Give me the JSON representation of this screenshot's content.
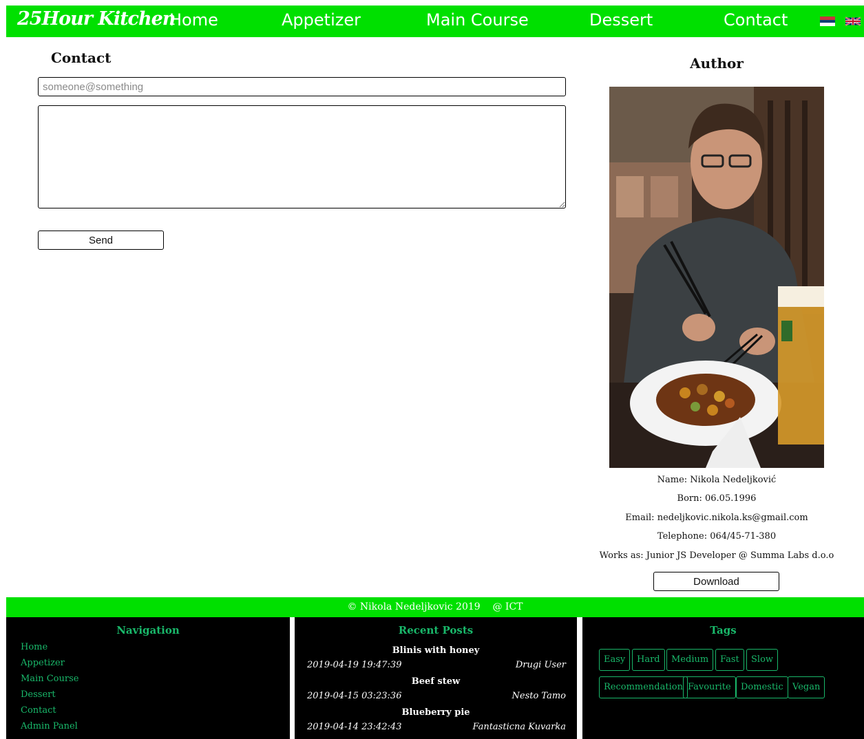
{
  "nav": {
    "brand": "25Hour Kitchen",
    "links": [
      "Home",
      "Appetizer",
      "Main Course",
      "Dessert",
      "Contact"
    ],
    "languages": [
      "serbian-flag",
      "uk-flag"
    ]
  },
  "contact": {
    "title": "Contact",
    "email_placeholder": "someone@something",
    "send_label": "Send"
  },
  "author": {
    "title": "Author",
    "name": "Name: Nikola Nedeljković",
    "born": "Born: 06.05.1996",
    "email": "Email: nedeljkovic.nikola.ks@gmail.com",
    "telephone": "Telephone: 064/45-71-380",
    "works_as": "Works as: Junior JS Developer @ Summa Labs d.o.o",
    "download_label": "Download"
  },
  "footer": {
    "copyright": "© Nikola Nedeljkovic 2019    @ ICT",
    "navigation": {
      "heading": "Navigation",
      "links": [
        "Home",
        "Appetizer",
        "Main Course",
        "Dessert",
        "Contact",
        "Admin Panel"
      ]
    },
    "recent_posts": {
      "heading": "Recent Posts",
      "posts": [
        {
          "title": "Blinis with honey",
          "date": "2019-04-19 19:47:39",
          "author": "Drugi User"
        },
        {
          "title": "Beef stew",
          "date": "2019-04-15 03:23:36",
          "author": "Nesto Tamo"
        },
        {
          "title": "Blueberry pie",
          "date": "2019-04-14 23:42:43",
          "author": "Fantasticna Kuvarka"
        }
      ]
    },
    "tags": {
      "heading": "Tags",
      "items": [
        "Easy",
        "Hard",
        "Medium",
        "Fast",
        "Slow",
        "Recommendation",
        "Favourite",
        "Domestic",
        "Vegan"
      ]
    }
  },
  "colors": {
    "accent_green": "#00e000",
    "footer_text_green": "#19b86a",
    "footer_bg": "#000000"
  }
}
